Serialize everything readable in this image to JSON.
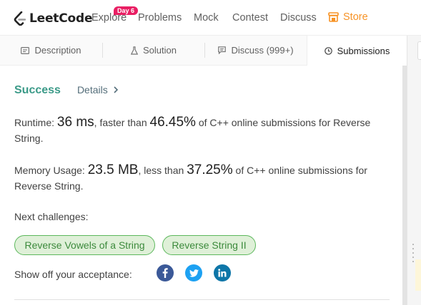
{
  "brand": {
    "name": "LeetCode"
  },
  "nav": {
    "explore": "Explore",
    "explore_badge": "Day 6",
    "problems": "Problems",
    "mock": "Mock",
    "contest": "Contest",
    "discuss": "Discuss",
    "store": "Store"
  },
  "tabs": {
    "description": "Description",
    "solution": "Solution",
    "discuss": "Discuss (999+)",
    "submissions": "Submissions"
  },
  "result": {
    "status": "Success",
    "details": "Details",
    "runtime_label": "Runtime:",
    "runtime_value": "36 ms",
    "runtime_mid": ", faster than",
    "runtime_percent": "46.45%",
    "runtime_tail": "of C++ online submissions for Reverse String.",
    "memory_label": "Memory Usage:",
    "memory_value": "23.5 MB",
    "memory_mid": ", less than",
    "memory_percent": "37.25%",
    "memory_tail": "of C++ online submissions for Reverse String."
  },
  "challenges": {
    "label": "Next challenges:",
    "items": [
      "Reverse Vowels of a String",
      "Reverse String II"
    ]
  },
  "share": {
    "label": "Show off your acceptance:"
  },
  "colors": {
    "success": "#3b9a88",
    "store": "#f79326",
    "badge": "#e91e63",
    "chip_bg": "#dff0d8",
    "chip_border": "#5cb85c"
  }
}
